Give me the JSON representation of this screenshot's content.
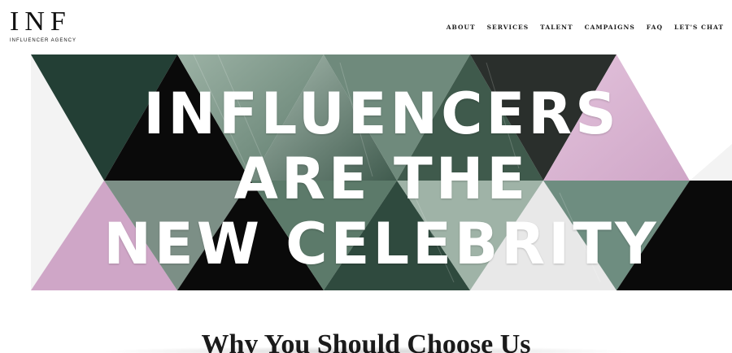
{
  "brand": {
    "mark": "INF",
    "sub": "INFLUENCER AGENCY"
  },
  "nav": {
    "items": [
      "ABOUT",
      "SERVICES",
      "TALENT",
      "CAMPAIGNS",
      "FAQ",
      "LET'S CHAT"
    ]
  },
  "hero": {
    "headline": [
      "INFLUENCERS",
      "ARE THE",
      "NEW CELEBRITY"
    ]
  },
  "section": {
    "title": "Why You Should Choose Us"
  },
  "colors": {
    "green": "#233f35",
    "pink": "#dcb7d4",
    "black": "#0a0a0a",
    "photo_green": "#7f9a8b",
    "photo_pink": "#c896bb",
    "light": "#f2f2f2"
  }
}
